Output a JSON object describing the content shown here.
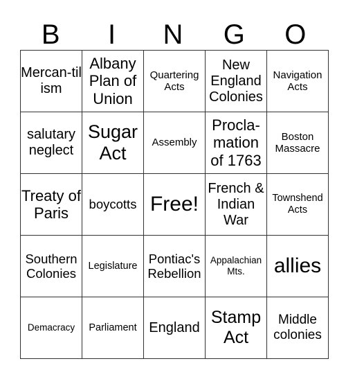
{
  "header": [
    "B",
    "I",
    "N",
    "G",
    "O"
  ],
  "rows": [
    [
      "Mercan-tilism",
      "Albany Plan of Union",
      "Quartering Acts",
      "New England Colonies",
      "Navigation Acts"
    ],
    [
      "salutary neglect",
      "Sugar Act",
      "Assembly",
      "Procla-mation of 1763",
      "Boston Massacre"
    ],
    [
      "Treaty of Paris",
      "boycotts",
      "Free!",
      "French & Indian War",
      "Townshend Acts"
    ],
    [
      "Southern Colonies",
      "Legislature",
      "Pontiac's Rebellion",
      "Appalachian Mts.",
      "allies"
    ],
    [
      "Demacracy",
      "Parliament",
      "England",
      "Stamp Act",
      "Middle colonies"
    ]
  ]
}
